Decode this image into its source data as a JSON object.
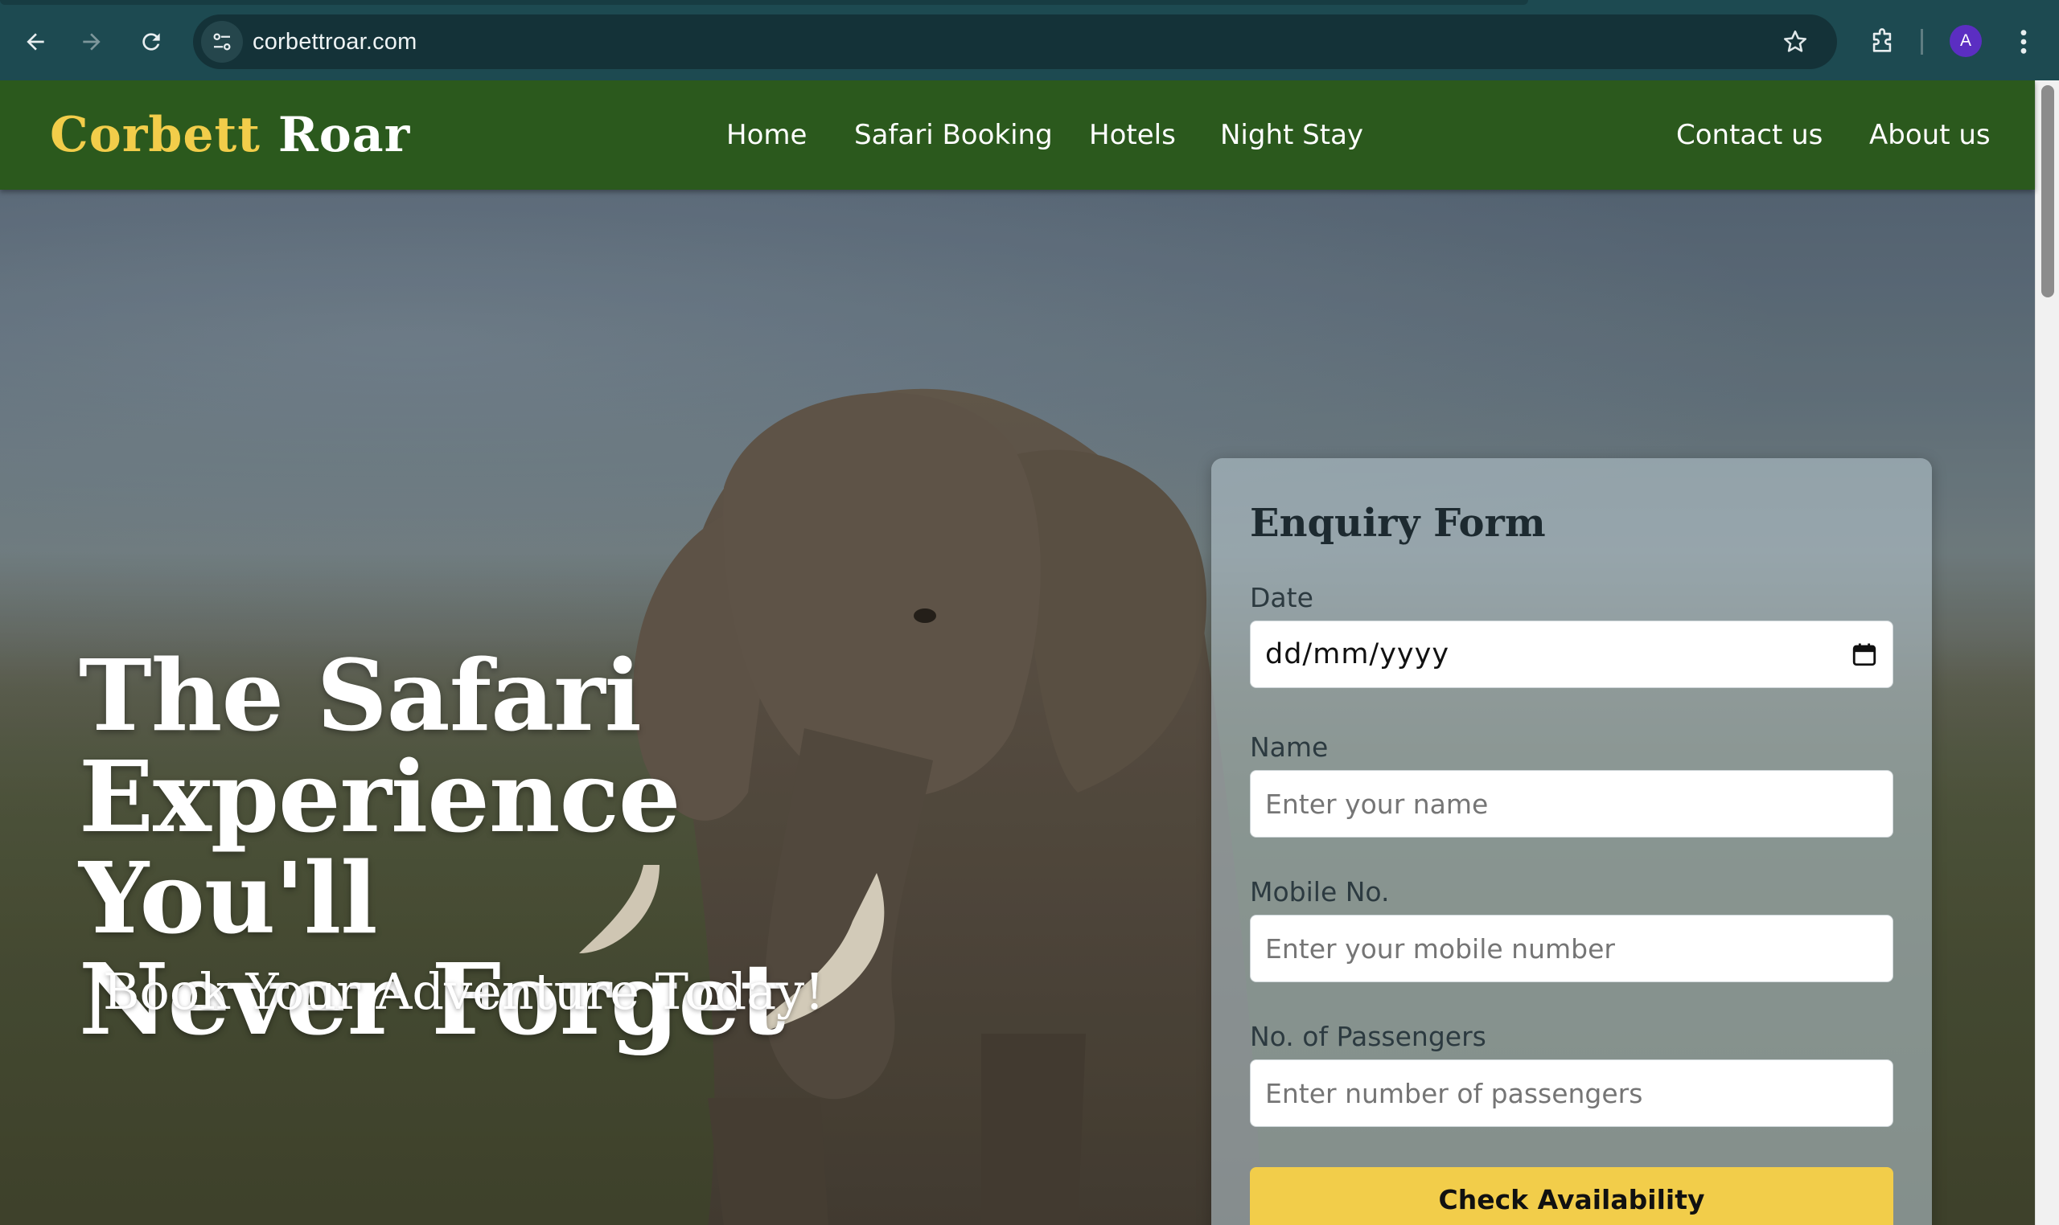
{
  "browser": {
    "url": "corbettroar.com",
    "avatar_letter": "A"
  },
  "site": {
    "logo_part1": "Corbett",
    "logo_part2": "Roar",
    "nav": [
      {
        "label": "Home"
      },
      {
        "label": "Safari Booking"
      },
      {
        "label": "Hotels"
      },
      {
        "label": "Night Stay"
      },
      {
        "label": "Contact us"
      },
      {
        "label": "About us"
      }
    ]
  },
  "hero": {
    "headline_line1": "The Safari",
    "headline_line2": "Experience You'll",
    "headline_line3": "Never Forget",
    "subline": "Book Your Adventure Today!"
  },
  "form": {
    "title": "Enquiry Form",
    "date_label": "Date",
    "date_value": "dd/mm/yyyy",
    "name_label": "Name",
    "name_placeholder": "Enter your name",
    "mobile_label": "Mobile No.",
    "mobile_placeholder": "Enter your mobile number",
    "passengers_label": "No. of Passengers",
    "passengers_placeholder": "Enter number of passengers",
    "submit_label": "Check Availability"
  },
  "colors": {
    "header_bg": "#2b591d",
    "logo_accent": "#f2cd4a",
    "button_bg": "#f2cd4a",
    "chrome_bg": "#1d4a51"
  },
  "icons": [
    "back-icon",
    "forward-icon",
    "reload-icon",
    "site-info-icon",
    "star-icon",
    "extensions-icon",
    "more-icon",
    "calendar-icon"
  ]
}
